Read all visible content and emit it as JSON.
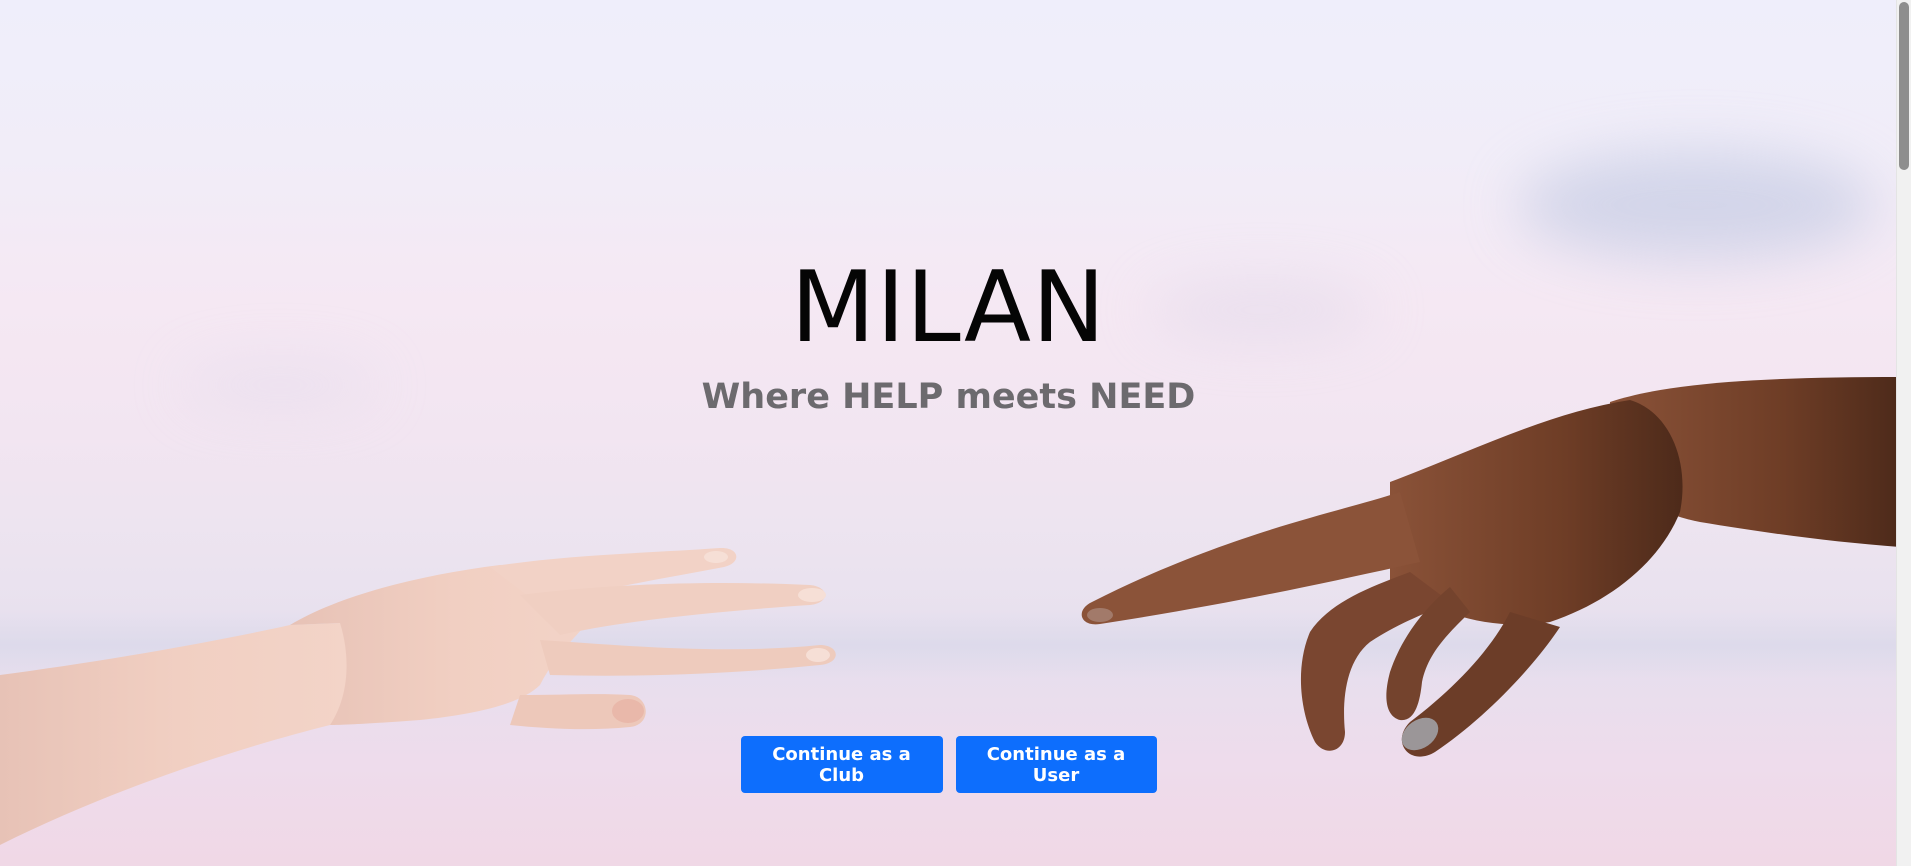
{
  "hero": {
    "title": "MILAN",
    "subtitle": "Where HELP meets NEED"
  },
  "actions": {
    "club_label": "Continue as a Club",
    "user_label": "Continue as a User"
  },
  "colors": {
    "accent": "#0d6efd",
    "title": "#050505",
    "subtitle": "#6c6a6e"
  },
  "icons": {
    "left_hand": "reaching-hand-light",
    "right_hand": "pointing-hand-dark"
  }
}
